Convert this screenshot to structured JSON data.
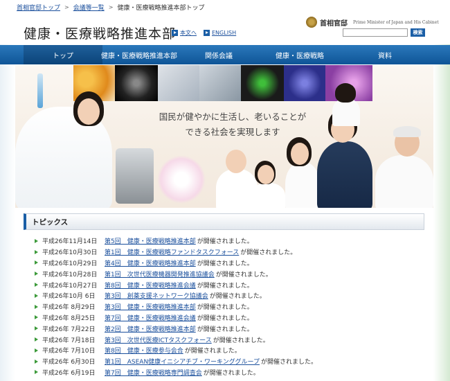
{
  "breadcrumb": {
    "items": [
      "首相官邸トップ",
      "会議等一覧",
      "健康・医療戦略推進本部トップ"
    ]
  },
  "header": {
    "site_title": "健康・医療戦略推進本部",
    "lang_japanese": "本文へ",
    "lang_english": "ENGLISH",
    "kantei_name": "首相官邸",
    "kantei_english": "Prime Minister of Japan and His Cabinet",
    "search_placeholder": "",
    "search_button": "検索"
  },
  "nav": {
    "items": [
      "トップ",
      "健康・医療戦略推進本部",
      "関係会議",
      "健康・医療戦略",
      "資料"
    ]
  },
  "hero": {
    "tagline_line1": "国民が健やかに生活し、老いることが",
    "tagline_line2": "できる社会を実現します"
  },
  "topics": {
    "title": "トピックス",
    "suffix": "が開催されました。",
    "items": [
      {
        "date": "平成26年11月14日",
        "link": "第5回　健康・医療戦略推進本部"
      },
      {
        "date": "平成26年10月30日",
        "link": "第1回　健康・医療戦略ファンドタスクフォース"
      },
      {
        "date": "平成26年10月29日",
        "link": "第4回　健康・医療戦略推進本部"
      },
      {
        "date": "平成26年10月28日",
        "link": "第1回　次世代医療機器開発推進協議会"
      },
      {
        "date": "平成26年10月27日",
        "link": "第8回　健康・医療戦略推進会議"
      },
      {
        "date": "平成26年10月 6日",
        "link": "第3回　創薬支援ネットワーク協議会"
      },
      {
        "date": "平成26年 8月29日",
        "link": "第3回　健康・医療戦略推進本部"
      },
      {
        "date": "平成26年 8月25日",
        "link": "第7回　健康・医療戦略推進会議"
      },
      {
        "date": "平成26年 7月22日",
        "link": "第2回　健康・医療戦略推進本部"
      },
      {
        "date": "平成26年 7月18日",
        "link": "第3回　次世代医療ICTタスクフォース"
      },
      {
        "date": "平成26年 7月10日",
        "link": "第8回　健康・医療参与会合"
      },
      {
        "date": "平成26年 6月30日",
        "link": "第1回　ASEAN健康イニシアチブ・ワーキンググループ"
      },
      {
        "date": "平成26年 6月19日",
        "link": "第7回　健康・医療戦略専門調査会"
      }
    ]
  }
}
